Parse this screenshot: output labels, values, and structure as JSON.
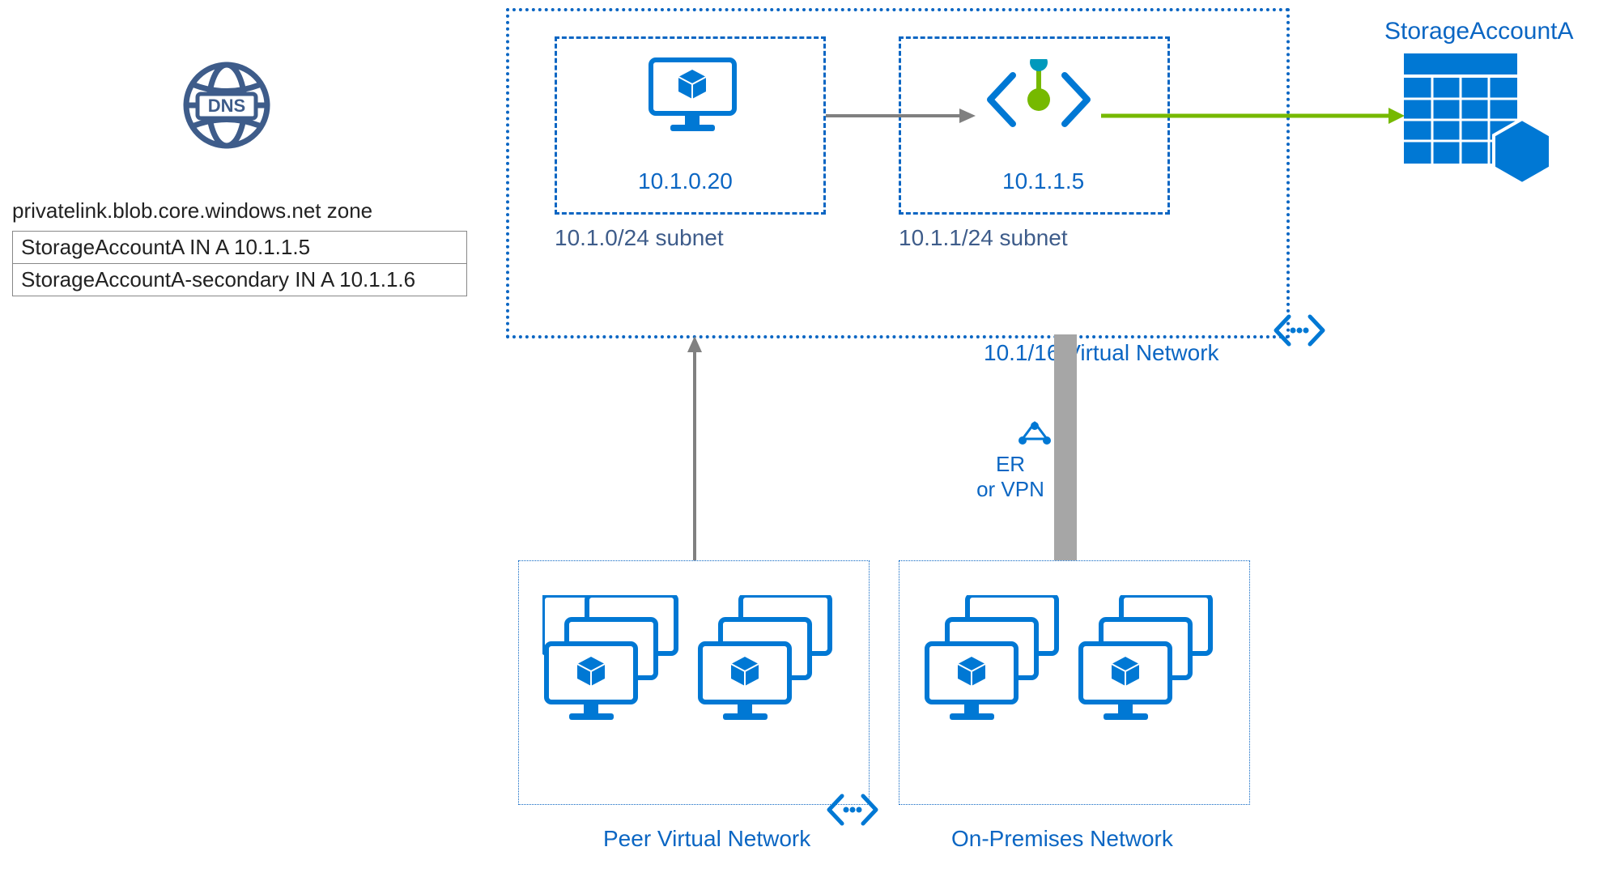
{
  "dns": {
    "zone_title": "privatelink.blob.core.windows.net zone",
    "records": [
      "StorageAccountA IN A 10.1.1.5",
      "StorageAccountA-secondary IN A 10.1.1.6"
    ]
  },
  "vnet": {
    "label": "10.1/16 Virtual Network",
    "subnets": [
      {
        "cidr_label": "10.1.0/24 subnet",
        "vm_ip": "10.1.0.20"
      },
      {
        "cidr_label": "10.1.1/24 subnet",
        "private_endpoint_ip": "10.1.1.5"
      }
    ]
  },
  "storage": {
    "name": "StorageAccountA"
  },
  "gateway": {
    "icon_label": "ER",
    "label_top": "ER",
    "label_bottom": "or VPN"
  },
  "lower_networks": {
    "peer_label": "Peer Virtual Network",
    "onprem_label": "On-Premises Network"
  },
  "colors": {
    "azure_blue": "#0078D4",
    "dark_blue": "#3e5c8a",
    "arrow_gray": "#808080",
    "green": "#76b900",
    "teal": "#0099bc"
  }
}
